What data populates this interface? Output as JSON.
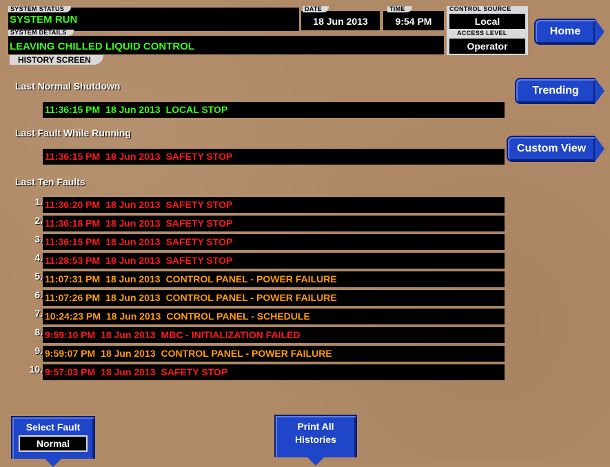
{
  "header": {
    "system_status_label": "SYSTEM STATUS",
    "system_status_value": "SYSTEM RUN",
    "system_details_label": "SYSTEM DETAILS",
    "system_details_value": "LEAVING CHILLED LIQUID CONTROL",
    "date_label": "DATE",
    "date_value": "18 Jun 2013",
    "time_label": "TIME",
    "time_value": "9:54 PM",
    "control_source_label": "CONTROL SOURCE",
    "control_source_value": "Local",
    "access_level_label": "ACCESS LEVEL",
    "access_level_value": "Operator",
    "screen_tab": "HISTORY SCREEN"
  },
  "nav": {
    "home": "Home",
    "trending": "Trending",
    "custom_view": "Custom View"
  },
  "sections": {
    "last_normal_shutdown": {
      "title": "Last Normal Shutdown",
      "time": "11:36:15 PM",
      "date": "18 Jun 2013",
      "reason": "LOCAL STOP",
      "color": "#39ff14"
    },
    "last_fault_running": {
      "title": "Last Fault While Running",
      "time": "11:36:15 PM",
      "date": "18 Jun 2013",
      "reason": "SAFETY STOP",
      "color": "#ff1a1a"
    },
    "last_ten_faults_title": "Last Ten Faults"
  },
  "faults": [
    {
      "num": "1.",
      "time": "11:36:20 PM",
      "date": "18 Jun 2013",
      "reason": "SAFETY STOP",
      "color": "#ff1a1a"
    },
    {
      "num": "2.",
      "time": "11:36:18 PM",
      "date": "18 Jun 2013",
      "reason": "SAFETY STOP",
      "color": "#ff1a1a"
    },
    {
      "num": "3.",
      "time": "11:36:15 PM",
      "date": "18 Jun 2013",
      "reason": "SAFETY STOP",
      "color": "#ff1a1a"
    },
    {
      "num": "4.",
      "time": "11:28:53 PM",
      "date": "18 Jun 2013",
      "reason": "SAFETY STOP",
      "color": "#ff1a1a"
    },
    {
      "num": "5.",
      "time": "11:07:31 PM",
      "date": "18 Jun 2013",
      "reason": "CONTROL PANEL - POWER FAILURE",
      "color": "#ff9d00"
    },
    {
      "num": "6.",
      "time": "11:07:26 PM",
      "date": "18 Jun 2013",
      "reason": "CONTROL PANEL - POWER FAILURE",
      "color": "#ff9d00"
    },
    {
      "num": "7.",
      "time": "10:24:23 PM",
      "date": "18 Jun 2013",
      "reason": "CONTROL PANEL - SCHEDULE",
      "color": "#ff9d00"
    },
    {
      "num": "8.",
      "time": "9:59:10 PM",
      "date": "18 Jun 2013",
      "reason": "MBC - INITIALIZATION FAILED",
      "color": "#ff1a1a"
    },
    {
      "num": "9.",
      "time": "9:59:07 PM",
      "date": "18 Jun 2013",
      "reason": "CONTROL PANEL - POWER FAILURE",
      "color": "#ff9d00"
    },
    {
      "num": "10.",
      "time": "9:57:03 PM",
      "date": "18 Jun 2013",
      "reason": "SAFETY STOP",
      "color": "#ff1a1a"
    }
  ],
  "bottom": {
    "select_fault_label": "Select Fault",
    "select_fault_value": "Normal",
    "print_line1": "Print All",
    "print_line2": "Histories"
  }
}
